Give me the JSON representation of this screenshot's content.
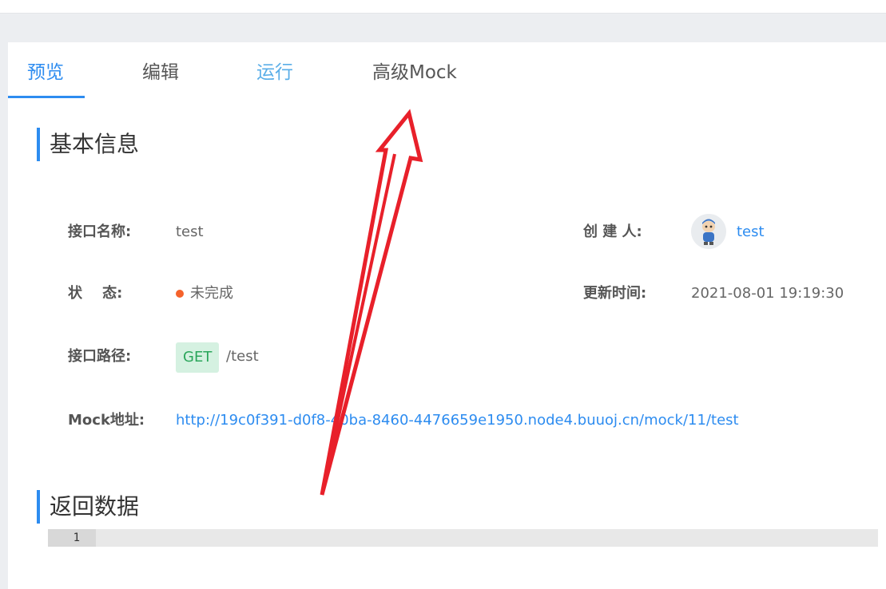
{
  "tabs": {
    "preview": "预览",
    "edit": "编辑",
    "run": "运行",
    "advanced_mock": "高级Mock"
  },
  "basic_info": {
    "title": "基本信息",
    "name_label": "接口名称:",
    "name_value": "test",
    "creator_label": "创 建 人:",
    "creator_value": "test",
    "status_label": "状    态:",
    "status_value": "未完成",
    "updated_label": "更新时间:",
    "updated_value": "2021-08-01 19:19:30",
    "path_label": "接口路径:",
    "method": "GET",
    "path_value": "/test",
    "mock_label": "Mock地址:",
    "mock_url": "http://19c0f391-d0f8-40ba-8460-4476659e1950.node4.buuoj.cn/mock/11/test"
  },
  "response": {
    "title": "返回数据",
    "line_number": "1"
  },
  "colors": {
    "accent": "#2d8cf0",
    "status_dot": "#f5622b",
    "method_bg": "#d5f1e1",
    "method_text": "#2ba65b",
    "annotation_arrow": "#e8202a"
  },
  "icons": {
    "status": "status-dot-icon",
    "avatar": "avatar-icon",
    "annotation": "red-arrow-annotation"
  }
}
